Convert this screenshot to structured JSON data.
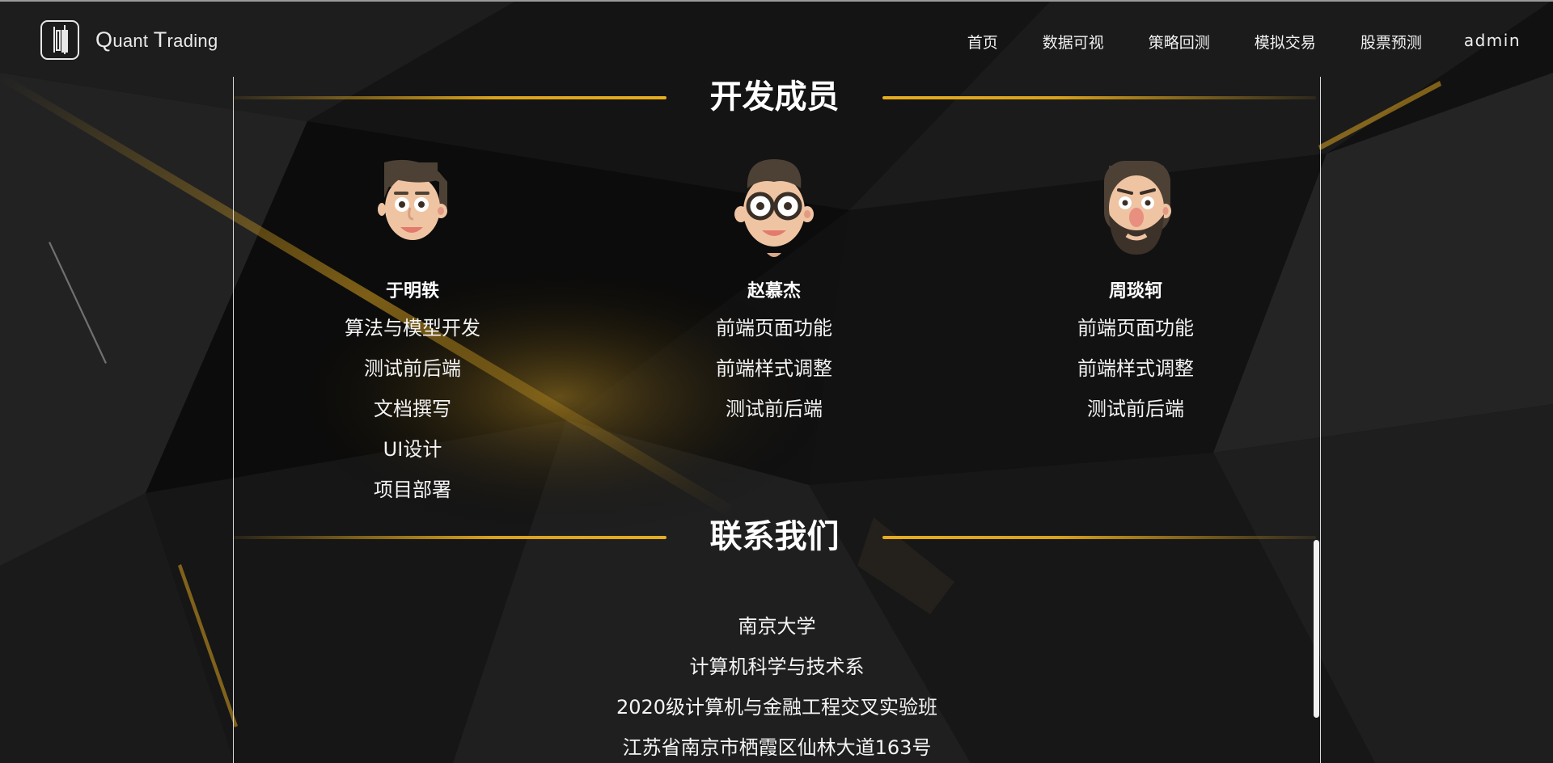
{
  "nav": {
    "brand_q": "Q",
    "brand_rest1": "uant ",
    "brand_t": "T",
    "brand_rest2": "rading",
    "menu": [
      "首页",
      "数据可视",
      "策略回测",
      "模拟交易",
      "股票预测"
    ],
    "user": "admin"
  },
  "sections": {
    "team_title": "开发成员",
    "contact_title": "联系我们"
  },
  "members": [
    {
      "name": "于明轶",
      "roles": [
        "算法与模型开发",
        "测试前后端",
        "文档撰写",
        "UI设计",
        "项目部署"
      ]
    },
    {
      "name": "赵慕杰",
      "roles": [
        "前端页面功能",
        "前端样式调整",
        "测试前后端"
      ]
    },
    {
      "name": "周琰轲",
      "roles": [
        "前端页面功能",
        "前端样式调整",
        "测试前后端"
      ]
    }
  ],
  "contact": [
    "南京大学",
    "计算机科学与技术系",
    "2020级计算机与金融工程交叉实验班",
    "江苏省南京市栖霞区仙林大道163号"
  ],
  "colors": {
    "accent_gold": "#e6ad1f",
    "background": "#0f0f10",
    "text": "#ffffff"
  }
}
